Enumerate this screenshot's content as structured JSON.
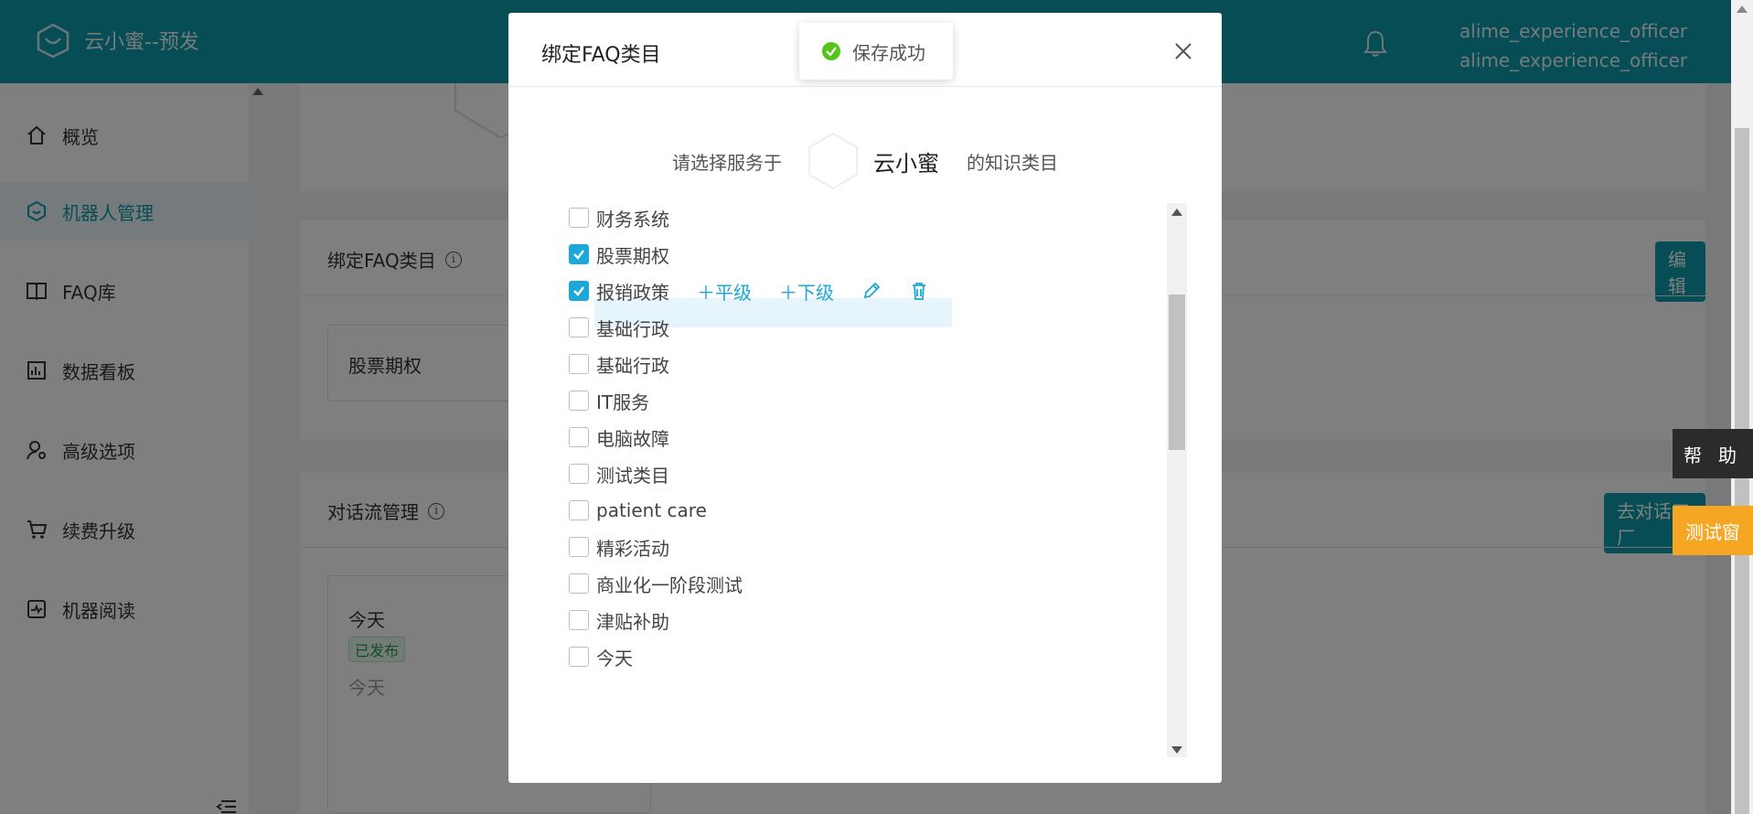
{
  "app": {
    "brand": "云小蜜--预发",
    "user_line1": "alime_experience_officer",
    "user_line2": "alime_experience_officer",
    "accent": "#0e9aaa"
  },
  "sidebar": {
    "items": [
      {
        "label": "概览",
        "icon": "home-icon"
      },
      {
        "label": "机器人管理",
        "icon": "robot-icon",
        "active": true
      },
      {
        "label": "FAQ库",
        "icon": "book-icon"
      },
      {
        "label": "数据看板",
        "icon": "dashboard-icon"
      },
      {
        "label": "高级选项",
        "icon": "user-settings-icon"
      },
      {
        "label": "续费升级",
        "icon": "cart-icon"
      },
      {
        "label": "机器阅读",
        "icon": "reading-icon"
      }
    ]
  },
  "main": {
    "faq_card": {
      "title": "绑定FAQ类目",
      "edit_label": "编 辑",
      "bound_item": "股票期权"
    },
    "dialog_card": {
      "title": "对话流管理",
      "factory_label": "去对话工厂",
      "flow_name": "今天",
      "status": "已发布",
      "flow_desc": "今天"
    }
  },
  "floating": {
    "help_label": "帮助",
    "test_label": "测试窗"
  },
  "modal": {
    "title": "绑定FAQ类目",
    "prompt_prefix": "请选择服务于",
    "bot_name": "云小蜜",
    "prompt_suffix": "的知识类目",
    "categories": [
      {
        "label": "财务系统",
        "checked": false
      },
      {
        "label": "股票期权",
        "checked": true
      },
      {
        "label": "报销政策",
        "checked": true,
        "hover": true
      },
      {
        "label": "基础行政",
        "checked": false
      },
      {
        "label": "基础行政",
        "checked": false
      },
      {
        "label": "IT服务",
        "checked": false
      },
      {
        "label": "电脑故障",
        "checked": false
      },
      {
        "label": "测试类目",
        "checked": false
      },
      {
        "label": "patient care",
        "checked": false
      },
      {
        "label": "精彩活动",
        "checked": false
      },
      {
        "label": "商业化一阶段测试",
        "checked": false
      },
      {
        "label": "津贴补助",
        "checked": false
      },
      {
        "label": "今天",
        "checked": false
      }
    ],
    "row_actions": {
      "add_sibling": "＋平级",
      "add_child": "＋下级",
      "edit_icon": "pencil-icon",
      "delete_icon": "trash-icon"
    }
  },
  "toast": {
    "message": "保存成功",
    "icon": "check-circle-icon",
    "color": "#52c41a"
  }
}
